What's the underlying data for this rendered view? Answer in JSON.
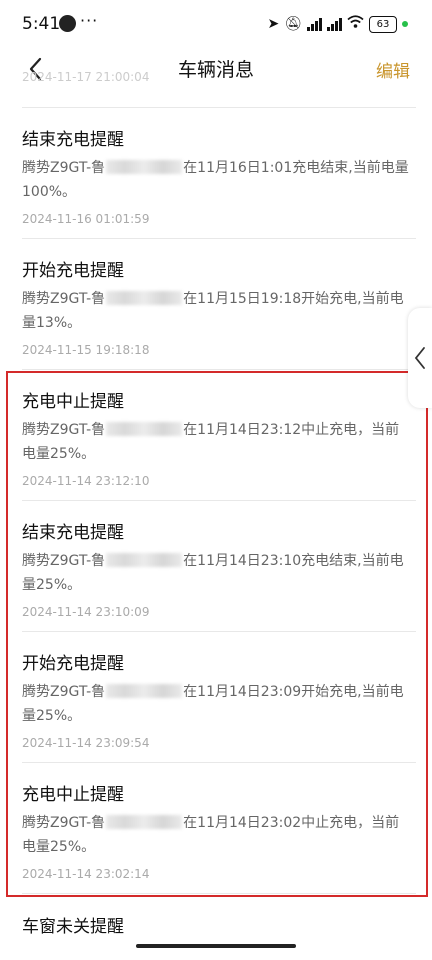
{
  "status_bar": {
    "time": "5:41",
    "dots": "···",
    "icons": [
      "location-icon",
      "mute-icon",
      "signal-icon",
      "signal-icon",
      "wifi-icon"
    ],
    "battery": "63"
  },
  "header": {
    "title": "车辆消息",
    "edit_label": "编辑"
  },
  "peek_text": "2024-11-17 21:00:04",
  "messages": [
    {
      "title": "结束充电提醒",
      "prefix": "腾势Z9GT-鲁",
      "suffix": "在11月16日1:01充电结束,当前电量100%。",
      "time": "2024-11-16 01:01:59"
    },
    {
      "title": "开始充电提醒",
      "prefix": "腾势Z9GT-鲁",
      "suffix": "在11月15日19:18开始充电,当前电量13%。",
      "time": "2024-11-15 19:18:18"
    },
    {
      "title": "充电中止提醒",
      "prefix": "腾势Z9GT-鲁",
      "suffix": "在11月14日23:12中止充电，当前电量25%。",
      "time": "2024-11-14 23:12:10"
    },
    {
      "title": "结束充电提醒",
      "prefix": "腾势Z9GT-鲁",
      "suffix": "在11月14日23:10充电结束,当前电量25%。",
      "time": "2024-11-14 23:10:09"
    },
    {
      "title": "开始充电提醒",
      "prefix": "腾势Z9GT-鲁",
      "suffix": "在11月14日23:09开始充电,当前电量25%。",
      "time": "2024-11-14 23:09:54"
    },
    {
      "title": "充电中止提醒",
      "prefix": "腾势Z9GT-鲁",
      "suffix": "在11月14日23:02中止充电，当前电量25%。",
      "time": "2024-11-14 23:02:14"
    },
    {
      "title": "车窗未关提醒",
      "prefix": "",
      "suffix": "",
      "time": ""
    }
  ],
  "colors": {
    "accent": "#c9952c",
    "highlight": "#d42a2a"
  }
}
